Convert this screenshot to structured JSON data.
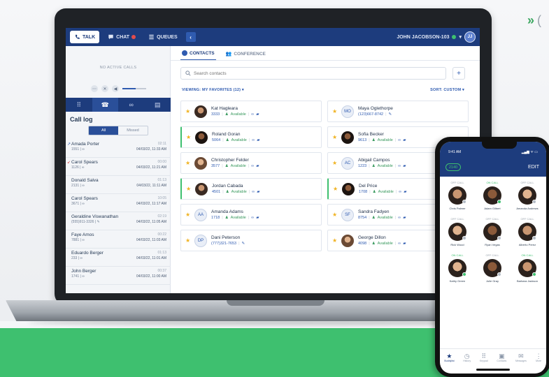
{
  "corner_link": {
    "arrow": "»",
    "text": "("
  },
  "topbar": {
    "tabs": [
      {
        "label": "TALK",
        "icon": "phone-icon",
        "active": true
      },
      {
        "label": "CHAT",
        "icon": "chat-icon",
        "active": false
      },
      {
        "label": "QUEUES",
        "icon": "queues-icon",
        "active": false
      }
    ],
    "collapse": "‹",
    "user": "JOHN JACOBSON-103",
    "user_initials": "JJ",
    "user_chevron": "▾"
  },
  "left": {
    "no_active_calls": "NO ACTIVE CALLS",
    "volume_level": 0.55,
    "tabs": [
      "⠿",
      "☎",
      "∞",
      "▤"
    ],
    "call_log_title": "Call log",
    "filter": {
      "all": "All",
      "missed": "Missed"
    },
    "calls": [
      {
        "dir": "↗",
        "missed": false,
        "name": "Amada Porter",
        "sub": "1551 | ∞",
        "dur": "02:11",
        "date": "04/03/22, 11:33 AM"
      },
      {
        "dir": "↙",
        "missed": true,
        "name": "Carol Spears",
        "sub": "1126 | ∞",
        "dur": "00:00",
        "date": "04/03/22, 11:21 AM"
      },
      {
        "dir": "",
        "missed": false,
        "name": "Donald Salva",
        "sub": "2131 | ∞",
        "dur": "01:13",
        "date": "04/03/22, 11:11 AM"
      },
      {
        "dir": "",
        "missed": false,
        "name": "Carol Spears",
        "sub": "3671 | ∞",
        "dur": "10:05",
        "date": "04/03/22, 11:17 AM"
      },
      {
        "dir": "",
        "missed": false,
        "name": "Geraldine Viswanathan",
        "sub": "(555)911-3326 | ✎",
        "dur": "02:19",
        "date": "04/03/22, 11:05 AM"
      },
      {
        "dir": "",
        "missed": false,
        "name": "Faye Amos",
        "sub": "7881 | ∞",
        "dur": "00:22",
        "date": "04/03/22, 11:03 AM"
      },
      {
        "dir": "",
        "missed": false,
        "name": "Eduardo Berger",
        "sub": "233 | ∞",
        "dur": "01:13",
        "date": "04/03/22, 11:01 AM"
      },
      {
        "dir": "",
        "missed": false,
        "name": "John Berger",
        "sub": "1741 | ∞",
        "dur": "00:37",
        "date": "04/03/22, 11:00 AM"
      }
    ]
  },
  "main": {
    "tabs": [
      {
        "label": "CONTACTS",
        "active": true
      },
      {
        "label": "CONFERENCE",
        "active": false
      }
    ],
    "search_placeholder": "Search contacts",
    "add": "+",
    "viewing": "VIEWING: MY FAVORITES (12) ▾",
    "sort": "SORT: CUSTOM ▾",
    "contacts": [
      {
        "name": "Kat Hagleara",
        "ext": "3333",
        "status": "Available",
        "avatar": "photo",
        "initials": "",
        "highlight": false
      },
      {
        "name": "Maya Oglethorpe",
        "ext": "(123)667-8742",
        "status": "",
        "avatar": "initials",
        "initials": "MO",
        "highlight": false
      },
      {
        "name": "Roland Goran",
        "ext": "5064",
        "status": "Available",
        "avatar": "photo3",
        "initials": "",
        "highlight": true
      },
      {
        "name": "Sofia Becker",
        "ext": "9613",
        "status": "Available",
        "avatar": "photo3",
        "initials": "",
        "highlight": false
      },
      {
        "name": "Christopher Felder",
        "ext": "3577",
        "status": "Available",
        "avatar": "photo2",
        "initials": "",
        "highlight": false
      },
      {
        "name": "Abigail Campos",
        "ext": "1223",
        "status": "Available",
        "avatar": "initials",
        "initials": "AC",
        "highlight": false
      },
      {
        "name": "Jordan Cabada",
        "ext": "4501",
        "status": "Available",
        "avatar": "photo",
        "initials": "",
        "highlight": true
      },
      {
        "name": "Del Price",
        "ext": "1708",
        "status": "Available",
        "avatar": "photo3",
        "initials": "",
        "highlight": true
      },
      {
        "name": "Amanda Adams",
        "ext": "1718",
        "status": "Available",
        "avatar": "initials",
        "initials": "AA",
        "highlight": false
      },
      {
        "name": "Sandra Fadyen",
        "ext": "8754",
        "status": "Available",
        "avatar": "initials",
        "initials": "SF",
        "highlight": false
      },
      {
        "name": "Dani Peterson",
        "ext": "(777)321-7653",
        "status": "",
        "avatar": "initials",
        "initials": "DP",
        "highlight": false
      },
      {
        "name": "George Dillon",
        "ext": "4098",
        "status": "Available",
        "avatar": "photo2",
        "initials": "",
        "highlight": false
      }
    ]
  },
  "phone": {
    "time": "9:41 AM",
    "signal": "▂▄▆ ᯤ ▭",
    "badge": "2140",
    "edit": "EDIT",
    "people": [
      {
        "status": "OFF CALL",
        "on": false,
        "name": "Chris Palmer",
        "tone": "#c99671"
      },
      {
        "status": "ON CALL",
        "on": true,
        "name": "Adam Gilbert",
        "tone": "#8b5a3a"
      },
      {
        "status": "OFF CALL",
        "on": false,
        "name": "Amanda Andrews",
        "tone": "#e1b48f"
      },
      {
        "status": "OFF CALL",
        "on": false,
        "name": "Rick Wood",
        "tone": "#e1b48f"
      },
      {
        "status": "OFF CALL",
        "on": false,
        "name": "Ryan Vegas",
        "tone": "#8b5a3a"
      },
      {
        "status": "OFF CALL",
        "on": false,
        "name": "Alberto Perez",
        "tone": "#c99671"
      },
      {
        "status": "ON CALL",
        "on": true,
        "name": "Kathy Green",
        "tone": "#e1b48f"
      },
      {
        "status": "OFF CALL",
        "on": false,
        "name": "Julie Gray",
        "tone": "#8b5a3a"
      },
      {
        "status": "ON CALL",
        "on": true,
        "name": "Barbara Jackson",
        "tone": "#c99671"
      }
    ],
    "nav": [
      {
        "glyph": "★",
        "label": "Buddylist",
        "active": true
      },
      {
        "glyph": "◷",
        "label": "History",
        "active": false
      },
      {
        "glyph": "⠿",
        "label": "Keypad",
        "active": false
      },
      {
        "glyph": "▣",
        "label": "Contacts",
        "active": false
      },
      {
        "glyph": "✉",
        "label": "Messages",
        "active": false
      },
      {
        "glyph": "⋮",
        "label": "More",
        "active": false
      }
    ]
  },
  "colors": {
    "brand": "#1d3c7d",
    "accent": "#2f5bb0",
    "green": "#3ec06f",
    "star": "#f0b322"
  }
}
